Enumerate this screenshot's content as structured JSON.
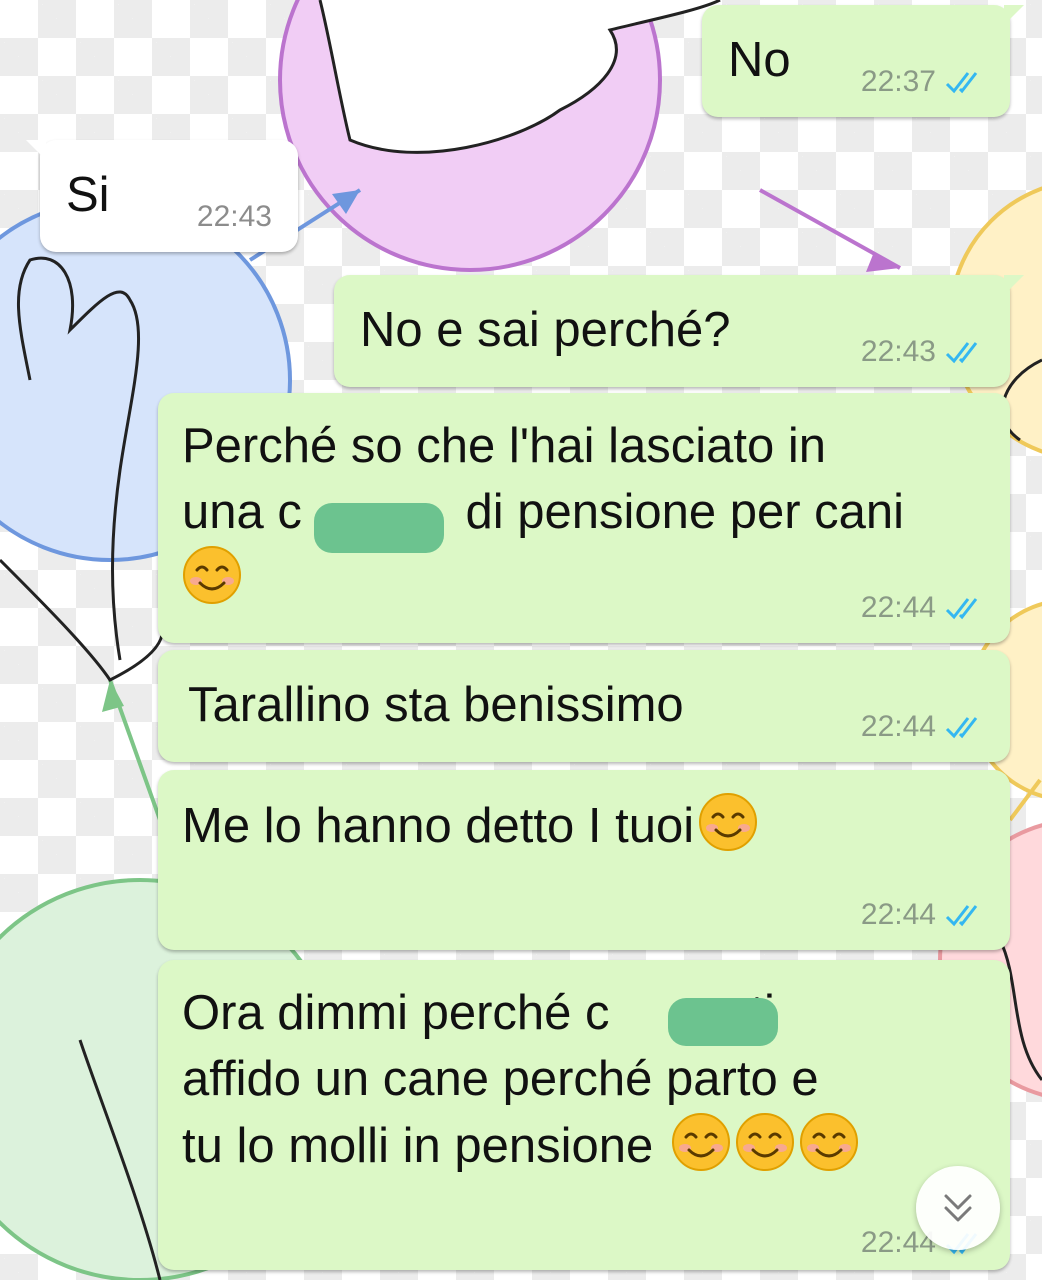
{
  "conversation": {
    "messages": [
      {
        "id": "m1",
        "direction": "outgoing",
        "text": "No",
        "time": "22:37",
        "status": "read"
      },
      {
        "id": "m2",
        "direction": "incoming",
        "text": "Si",
        "time": "22:43"
      },
      {
        "id": "m3",
        "direction": "outgoing",
        "text": "No e sai perché?",
        "time": "22:43",
        "status": "read"
      },
      {
        "id": "m4",
        "direction": "outgoing",
        "line1": "Perché so che l'hai lasciato in",
        "line2_pre": "una c",
        "line2_post": " di pensione per cani",
        "emoji": "smiling-face",
        "time": "22:44",
        "status": "read"
      },
      {
        "id": "m5",
        "direction": "outgoing",
        "text": "Tarallino sta benissimo",
        "time": "22:44",
        "status": "read"
      },
      {
        "id": "m6",
        "direction": "outgoing",
        "text": "Me lo hanno detto I tuoi",
        "emoji": "smiling-face",
        "time": "22:44",
        "status": "read"
      },
      {
        "id": "m7",
        "direction": "outgoing",
        "line1_pre": "Ora dimmi perché c",
        "line1_post": "o ti",
        "line2": "affido un cane perché parto e",
        "line3": "tu lo molli in pensione ",
        "emoji": "smiling-face",
        "emoji_count": 3,
        "time": "22:44",
        "status": "read"
      }
    ]
  },
  "colors": {
    "outgoing_bubble": "#dcf8c6",
    "incoming_bubble": "#ffffff",
    "read_ticks": "#34b7f1",
    "redaction": "#6cc38f"
  },
  "icons": {
    "read_receipt": "double-check-icon",
    "emoji": "smiling-face-emoji",
    "scroll_down": "chevron-double-down-icon"
  }
}
